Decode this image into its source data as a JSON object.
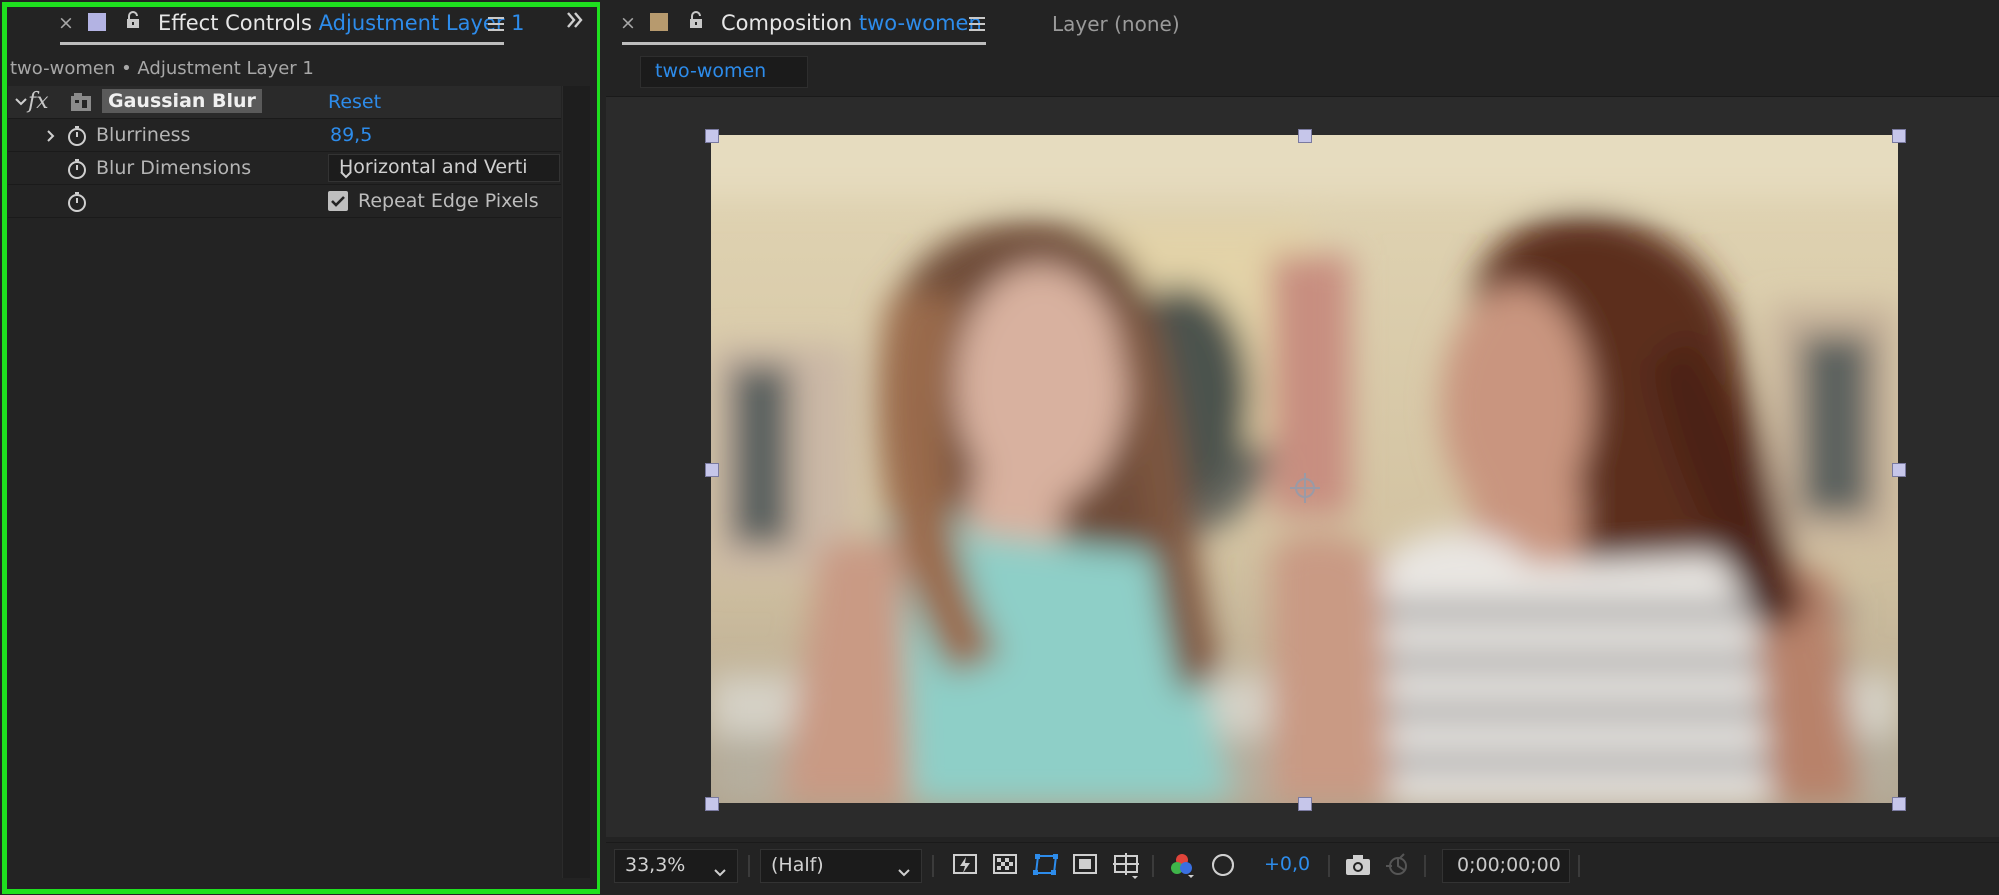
{
  "colors": {
    "accent": "#2d8ceb",
    "panel": "#232323",
    "highlight": "#1fe01f"
  },
  "effect_controls": {
    "close": "×",
    "tab_label": "Effect Controls",
    "tab_layer": "Adjustment Layer 1",
    "breadcrumb": "two-women • Adjustment Layer 1",
    "effect": {
      "fx": "fx",
      "name": "Gaussian Blur",
      "reset": "Reset",
      "properties": {
        "blurriness_label": "Blurriness",
        "blurriness_value": "89,5",
        "dimensions_label": "Blur Dimensions",
        "dimensions_value": "Horizontal and Verti",
        "repeat_edge_label": "Repeat Edge Pixels",
        "repeat_edge_checked": true
      }
    }
  },
  "composition": {
    "close": "×",
    "tab_label": "Composition",
    "tab_name": "two-women",
    "subtab": "two-women",
    "layer_tab": "Layer (none)"
  },
  "viewer_toolbar": {
    "zoom": "33,3%",
    "resolution": "(Half)",
    "exposure": "+0,0",
    "timecode": "0;00;00;00"
  }
}
